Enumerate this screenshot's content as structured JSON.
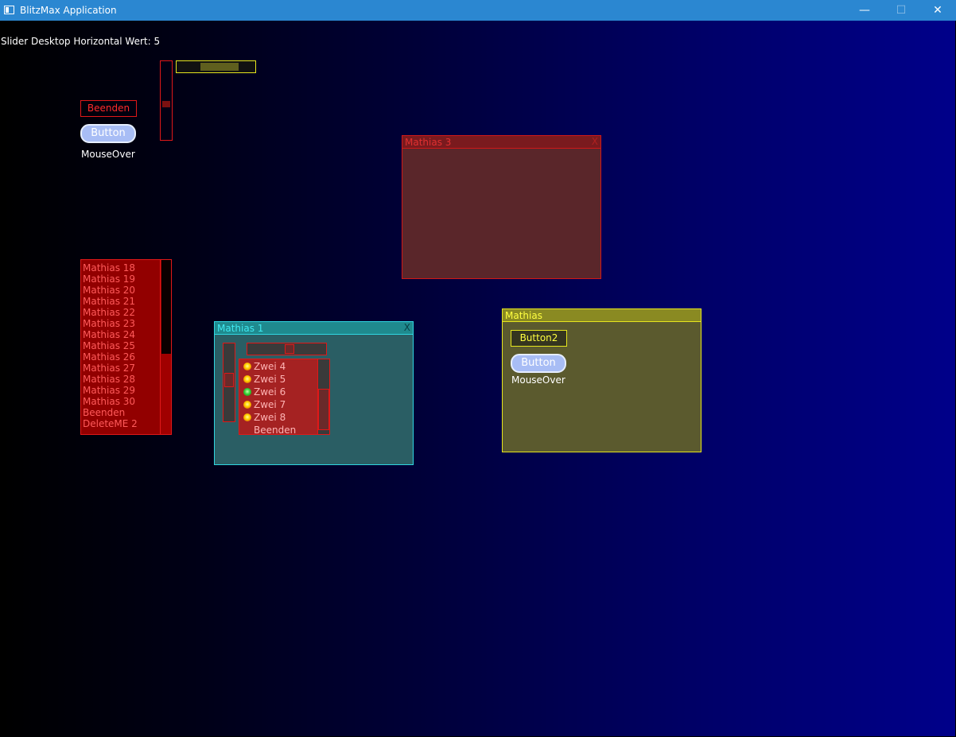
{
  "window": {
    "title": "BlitzMax Application",
    "minimize_glyph": "—",
    "maximize_glyph": "☐",
    "close_glyph": "✕"
  },
  "status": {
    "text": "Slider Desktop Horizontal Wert: 5"
  },
  "desktop": {
    "beenden_button": "Beenden",
    "pill_button": "Button",
    "mouseover_label": "MouseOver",
    "list_items": [
      "Mathias 18",
      "Mathias 19",
      "Mathias 20",
      "Mathias 21",
      "Mathias 22",
      "Mathias 23",
      "Mathias 24",
      "Mathias 25",
      "Mathias 26",
      "Mathias 27",
      "Mathias 28",
      "Mathias 29",
      "Mathias 30",
      "Beenden",
      "DeleteME 2"
    ]
  },
  "window_mathias3": {
    "title": "Mathias 3",
    "close": "X"
  },
  "window_mathias1": {
    "title": "Mathias 1",
    "close": "X",
    "list_items": [
      {
        "label": "Zwei 4",
        "status": "orange"
      },
      {
        "label": "Zwei 5",
        "status": "orange"
      },
      {
        "label": "Zwei 6",
        "status": "green"
      },
      {
        "label": "Zwei 7",
        "status": "orange"
      },
      {
        "label": "Zwei 8",
        "status": "orange"
      },
      {
        "label": "Beenden",
        "status": ""
      }
    ]
  },
  "window_mathias": {
    "title": "Mathias",
    "button2": "Button2",
    "pill_button": "Button",
    "mouseover_label": "MouseOver"
  },
  "colors": {
    "titlebar": "#2b87d1",
    "red": "#e01818",
    "listbg": "#920000",
    "cyan_window": "#2a5e64",
    "yellow_window": "#5b5a2e",
    "red_window": "#5a262a"
  }
}
